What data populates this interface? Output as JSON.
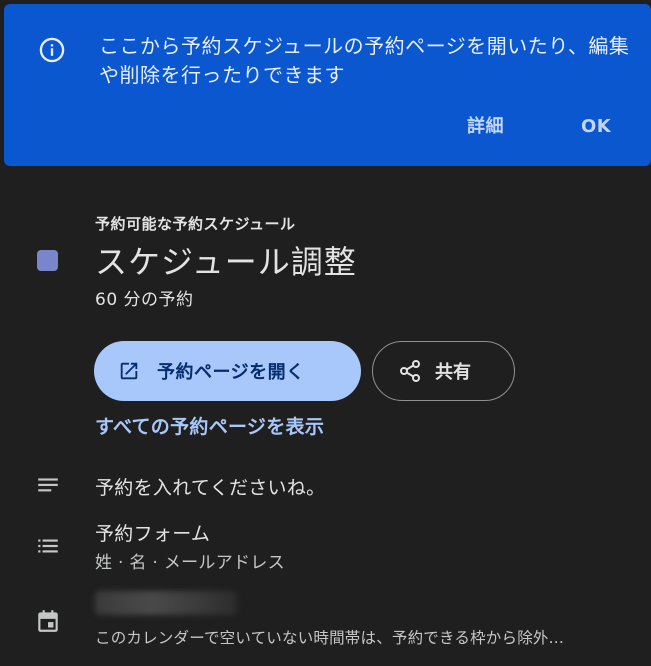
{
  "banner": {
    "icon": "info-icon",
    "text": "ここから予約スケジュールの予約ページを開いたり、編集や削除を行ったりできます",
    "details_label": "詳細",
    "ok_label": "OK",
    "background": "#0b57d0"
  },
  "schedule": {
    "overline": "予約可能な予約スケジュール",
    "title": "スケジュール調整",
    "duration": "60 分の予約",
    "color": "#7986cb"
  },
  "actions": {
    "open_page_label": "予約ページを開く",
    "open_page_icon": "open-in-new-icon",
    "share_label": "共有",
    "share_icon": "share-icon",
    "view_all_label": "すべての予約ページを表示"
  },
  "details": {
    "description_icon": "notes-icon",
    "description": "予約を入れてくださいね。",
    "form_icon": "list-icon",
    "form_title": "予約フォーム",
    "form_fields": "姓 · 名 · メールアドレス",
    "calendar_icon": "calendar-icon",
    "calendar_note": "このカレンダーで空いていない時間帯は、予約できる枠から除外..."
  }
}
